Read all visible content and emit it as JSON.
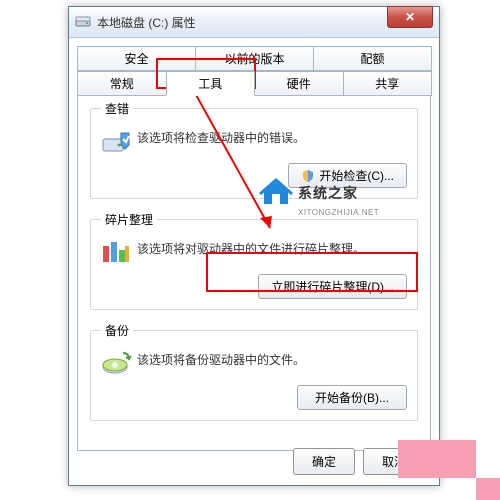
{
  "window": {
    "title": "本地磁盘 (C:) 属性"
  },
  "tabs": {
    "row1": [
      "安全",
      "以前的版本",
      "配额"
    ],
    "row2": [
      "常规",
      "工具",
      "硬件",
      "共享"
    ],
    "active": "工具"
  },
  "checkError": {
    "legend": "查错",
    "desc": "该选项将检查驱动器中的错误。",
    "btn": "开始检查(C)..."
  },
  "defrag": {
    "legend": "碎片整理",
    "desc": "该选项将对驱动器中的文件进行碎片整理。",
    "btn": "立即进行碎片整理(D)..."
  },
  "backup": {
    "legend": "备份",
    "desc": "该选项将备份驱动器中的文件。",
    "btn": "开始备份(B)..."
  },
  "footer": {
    "ok": "确定",
    "cancel": "取消"
  },
  "watermark": {
    "text": "系统之家",
    "sub": "XITONGZHIJIA.NET"
  }
}
